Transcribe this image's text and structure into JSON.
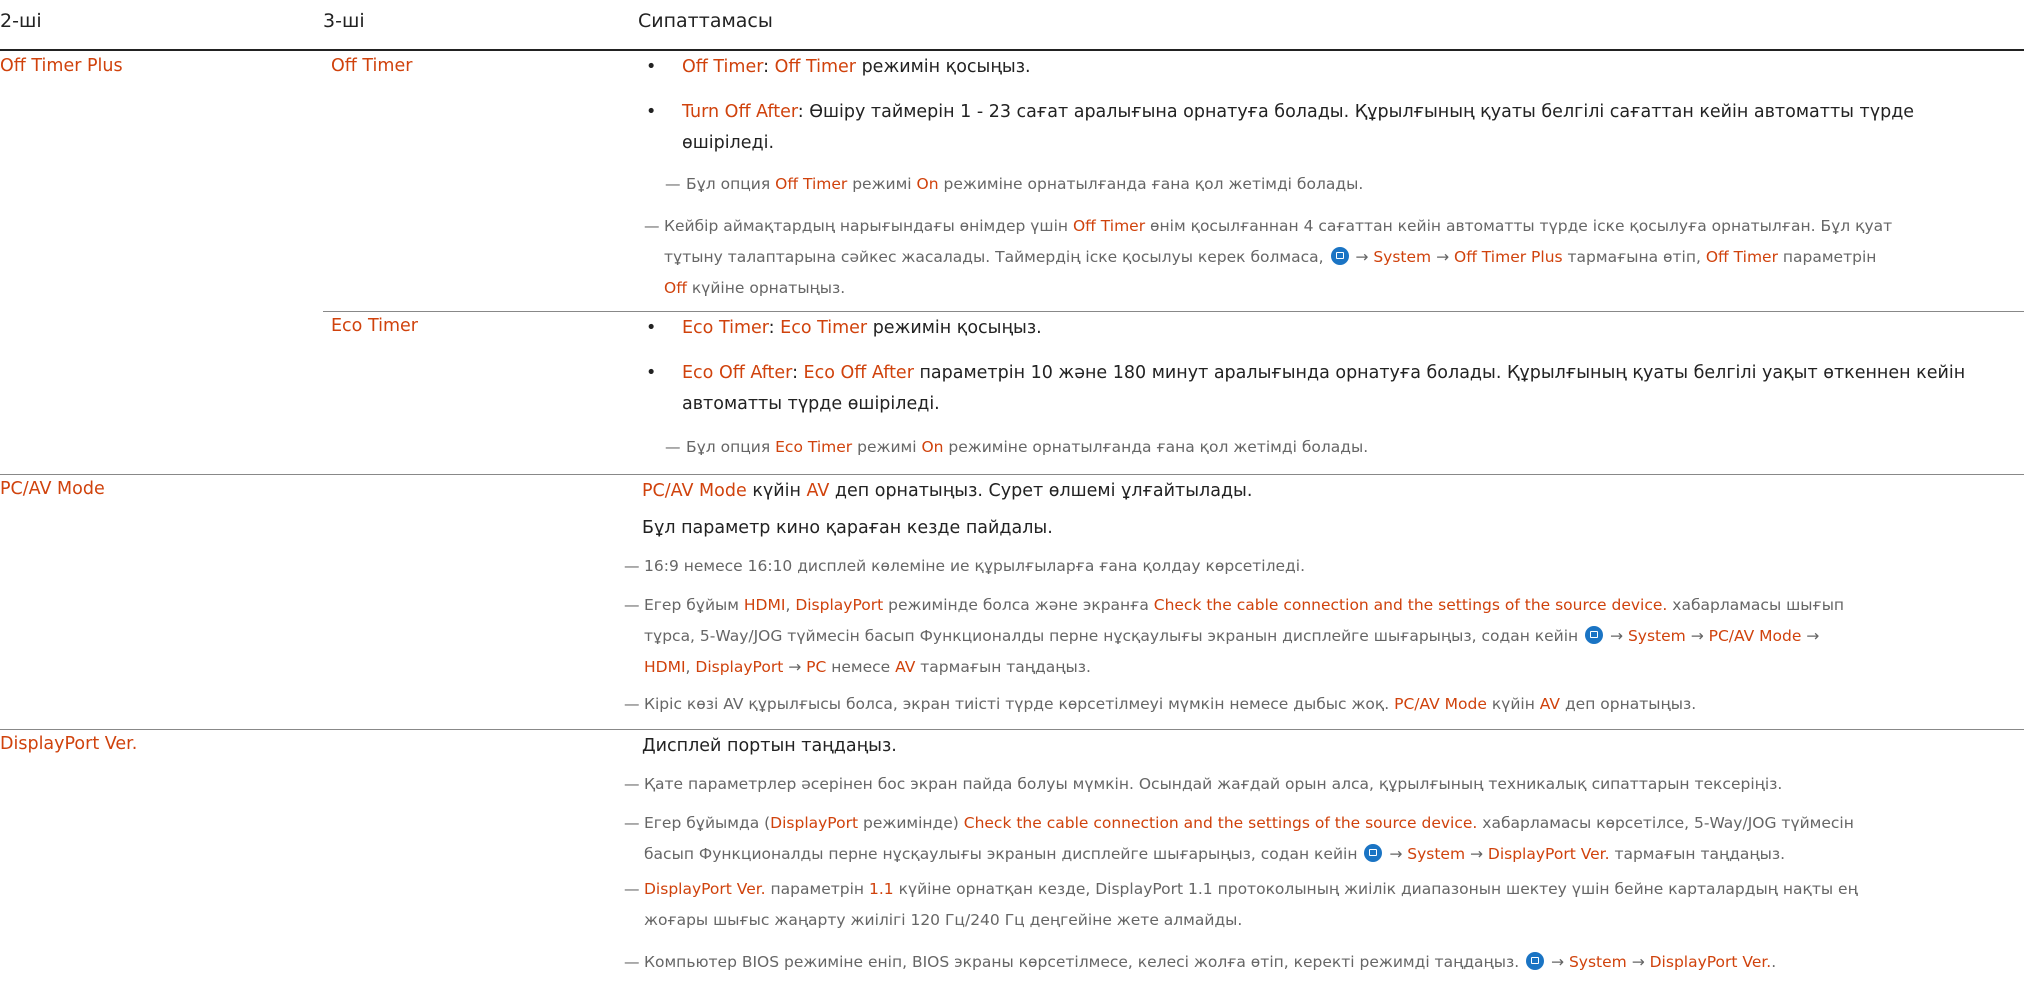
{
  "headers": {
    "col2": "2-ші",
    "col3": "3-ші",
    "col4": "Сипаттамасы"
  },
  "colors": {
    "highlight": "#d0420c",
    "note": "#666666",
    "menu_icon": "#1a74c4"
  },
  "offtimerplus": {
    "label": "Off Timer Plus",
    "offtimer": {
      "label": "Off Timer",
      "b1": [
        "Off Timer",
        ": ",
        "Off Timer",
        " режимін қосыңыз."
      ],
      "b2": [
        "Turn Off After",
        ": Өшіру таймерін 1 - 23 сағат аралығына орнатуға болады. Құрылғының қуаты белгілі сағаттан кейін автоматты түрде",
        "өшіріледі."
      ],
      "note1": [
        "Бұл опция ",
        "Off Timer",
        " режимі ",
        "On",
        " режиміне орнатылғанда ғана қол жетімді болады."
      ],
      "note2": [
        "Кейбір аймақтардың нарығындағы өнімдер үшін ",
        "Off Timer",
        " өнім қосылғаннан 4 сағаттан кейін автоматты түрде іске қосылуға орнатылған. Бұл қуат",
        "тұтыну талаптарына сәйкес жасалады. Таймердің іске қосылуы керек болмаса, ",
        " → ",
        "System",
        " → ",
        "Off Timer Plus",
        " тармағына өтіп, ",
        "Off Timer",
        " параметрін",
        "Off",
        " күйіне орнатыңыз."
      ]
    },
    "ecotimer": {
      "label": "Eco Timer",
      "b1": [
        "Eco Timer",
        ": ",
        "Eco Timer",
        " режимін қосыңыз."
      ],
      "b2": [
        "Eco Off After",
        ": ",
        "Eco Off After",
        " параметрін 10 және 180 минут аралығында орнатуға болады. Құрылғының қуаты белгілі уақыт өткеннен кейін",
        "автоматты түрде өшіріледі."
      ],
      "note1": [
        "Бұл опция ",
        "Eco Timer",
        " режимі ",
        "On",
        " режиміне орнатылғанда ғана қол жетімді болады."
      ]
    }
  },
  "pcav": {
    "label": "PC/AV Mode",
    "l1": [
      "PC/AV Mode",
      " күйін ",
      "AV",
      " деп орнатыңыз. Сурет өлшемі ұлғайтылады."
    ],
    "l2": "Бұл параметр кино қараған кезде пайдалы.",
    "n1": "16:9 немесе 16:10 дисплей көлеміне ие құрылғыларға ғана қолдау көрсетіледі.",
    "n2": [
      "Егер бұйым ",
      "HDMI",
      ", ",
      "DisplayPort",
      " режимінде болса және экранға ",
      "Check the cable connection and the settings of the source device.",
      " хабарламасы шығып",
      "тұрса, 5-Way/JOG түймесін басып Функционалды перне нұсқаулығы экранын дисплейге шығарыңыз, содан кейін ",
      " → ",
      "System",
      " → ",
      "PC/AV Mode",
      " →",
      "HDMI",
      ", ",
      "DisplayPort",
      " → ",
      "PC",
      " немесе ",
      "AV",
      " тармағын таңдаңыз."
    ],
    "n3": [
      "Кіріс көзі AV құрылғысы болса, экран тиісті түрде көрсетілмеуі мүмкін немесе дыбыс жоқ. ",
      "PC/AV Mode",
      " күйін ",
      "AV",
      " деп орнатыңыз."
    ]
  },
  "dpver": {
    "label": "DisplayPort Ver.",
    "l1": "Дисплей портын таңдаңыз.",
    "n1": "Қате параметрлер әсерінен бос экран пайда болуы мүмкін. Осындай жағдай орын алса, құрылғының техникалық сипаттарын тексеріңіз.",
    "n2": [
      "Егер бұйымда (",
      "DisplayPort",
      " режимінде) ",
      "Check the cable connection and the settings of the source device.",
      " хабарламасы көрсетілсе, 5-Way/JOG түймесін",
      "басып Функционалды перне нұсқаулығы экранын дисплейге шығарыңыз, содан кейін ",
      " → ",
      "System",
      " → ",
      "DisplayPort Ver.",
      " тармағын таңдаңыз."
    ],
    "n3": [
      "DisplayPort Ver.",
      " параметрін ",
      "1.1",
      " күйіне орнатқан кезде, DisplayPort 1.1 протоколының жиілік диапазонын шектеу үшін бейне карталардың нақты ең",
      "жоғары шығыс жаңарту жиілігі 120 Гц/240 Гц деңгейіне жете алмайды."
    ],
    "n4": [
      "Компьютер BIOS режиміне еніп, BIOS экраны көрсетілмесе, келесі жолға өтіп, керекті режимді таңдаңыз. ",
      " → ",
      "System",
      " → ",
      "DisplayPort Ver.",
      "."
    ]
  }
}
